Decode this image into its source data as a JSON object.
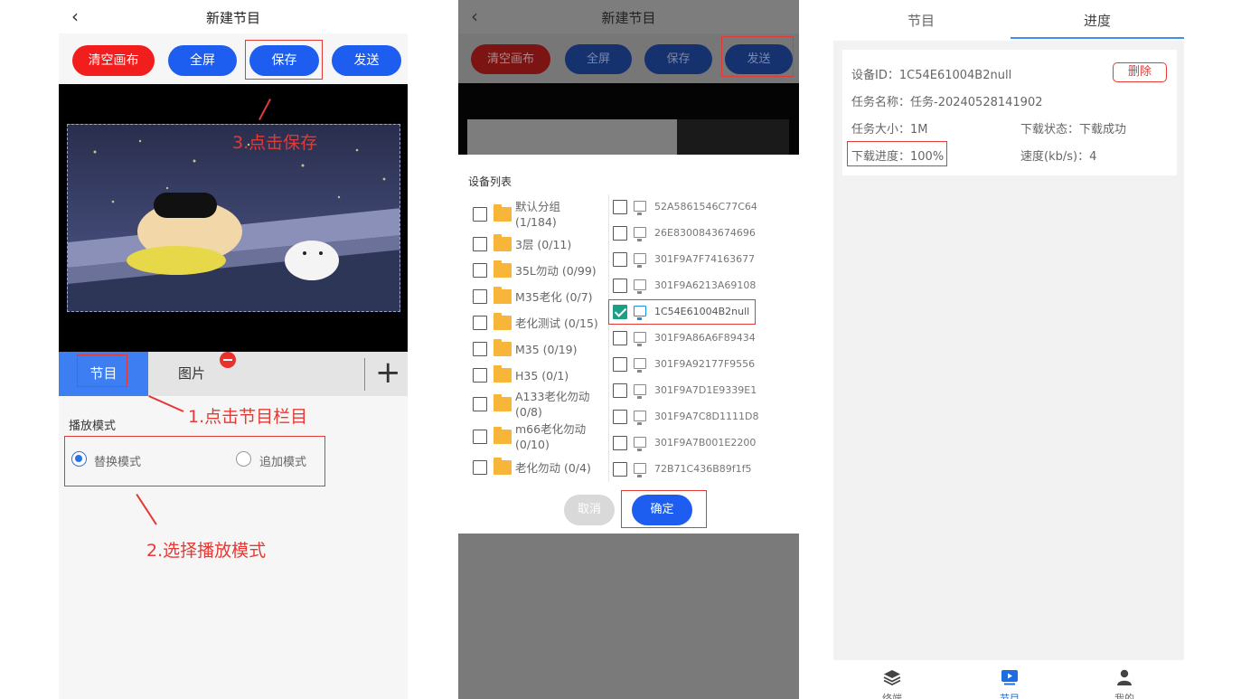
{
  "panel1": {
    "back_glyph": "‹",
    "title": "新建节目",
    "buttons": {
      "clear": "清空画布",
      "fullscreen": "全屏",
      "save": "保存",
      "send": "发送"
    },
    "tabs": {
      "program": "节目",
      "image": "图片",
      "add": "+"
    },
    "play_mode": {
      "label": "播放模式",
      "replace": "替换模式",
      "append": "追加模式",
      "selected": "replace"
    },
    "annotations": {
      "step1": "1.点击节目栏目",
      "step2": "2.选择播放模式",
      "step3": "3.点击保存"
    }
  },
  "panel2": {
    "back_glyph": "‹",
    "title": "新建节目",
    "buttons": {
      "clear": "清空画布",
      "fullscreen": "全屏",
      "save": "保存",
      "send": "发送"
    },
    "device_list_title": "设备列表",
    "groups": [
      {
        "label": "默认分组\n(1/184)"
      },
      {
        "label": "3层 (0/11)"
      },
      {
        "label": "35L勿动 (0/99)"
      },
      {
        "label": "M35老化 (0/7)"
      },
      {
        "label": "老化测试 (0/15)"
      },
      {
        "label": "M35 (0/19)"
      },
      {
        "label": "H35 (0/1)"
      },
      {
        "label": "A133老化勿动\n(0/8)"
      },
      {
        "label": "m66老化勿动\n(0/10)"
      },
      {
        "label": "老化勿动 (0/4)"
      }
    ],
    "devices": [
      {
        "id": "52A5861546C77C64",
        "checked": false
      },
      {
        "id": "26E8300843674696",
        "checked": false
      },
      {
        "id": "301F9A7F74163677",
        "checked": false
      },
      {
        "id": "301F9A6213A69108",
        "checked": false
      },
      {
        "id": "1C54E61004B2null",
        "checked": true
      },
      {
        "id": "301F9A86A6F89434",
        "checked": false
      },
      {
        "id": "301F9A92177F9556",
        "checked": false
      },
      {
        "id": "301F9A7D1E9339E1",
        "checked": false
      },
      {
        "id": "301F9A7C8D1111D8",
        "checked": false
      },
      {
        "id": "301F9A7B001E2200",
        "checked": false
      },
      {
        "id": "72B71C436B89f1f5",
        "checked": false
      }
    ],
    "cancel": "取消",
    "confirm": "确定"
  },
  "panel3": {
    "tabs": {
      "program": "节目",
      "progress": "进度",
      "active": "progress"
    },
    "task": {
      "device_id": "设备ID：1C54E61004B2null",
      "task_name": "任务名称：任务-20240528141902",
      "task_size": "任务大小：1M",
      "download_status": "下载状态：下载成功",
      "download_progress": "下载进度：100%",
      "speed": "速度(kb/s)：4",
      "delete": "删除"
    },
    "nav": {
      "terminal": "终端",
      "program": "节目",
      "mine": "我的",
      "active": "program"
    }
  },
  "colors": {
    "red": "#f21d1d",
    "blue": "#1d5ef0",
    "tab_blue": "#3d7ef2",
    "annotation_red": "#e53935",
    "check_green": "#1aa086"
  }
}
